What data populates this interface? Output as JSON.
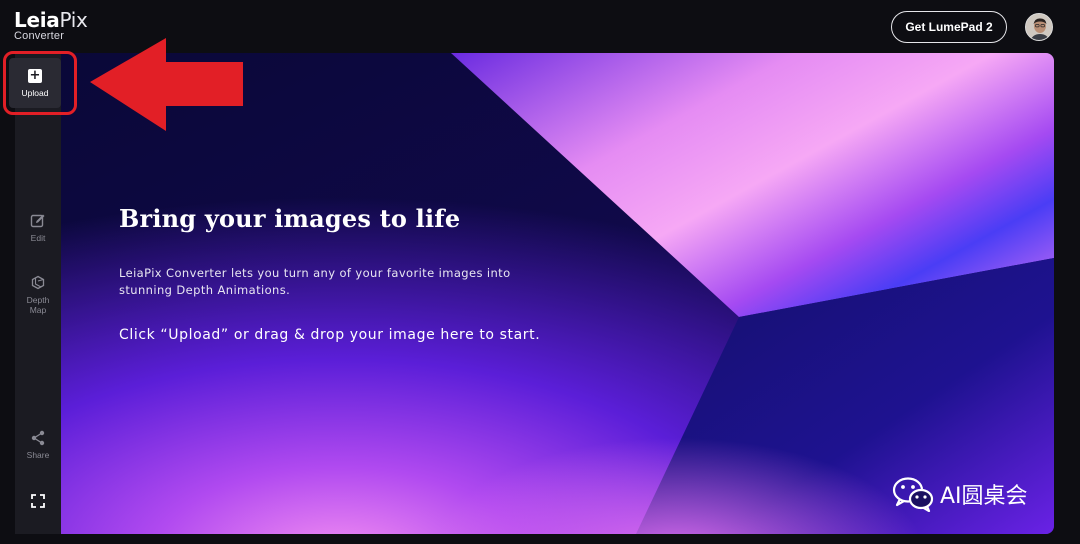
{
  "header": {
    "logo_bold": "Leia",
    "logo_thin": "Pix",
    "logo_sub": "Converter",
    "cta_label": "Get LumePad 2"
  },
  "sidebar": {
    "upload_label": "Upload",
    "items": [
      {
        "label": "Edit",
        "icon": "edit-icon"
      },
      {
        "label": "Depth Map",
        "icon": "depth-map-icon"
      },
      {
        "label": "Share",
        "icon": "share-icon"
      },
      {
        "label": "",
        "icon": "fullscreen-icon"
      }
    ]
  },
  "main": {
    "headline": "Bring your images to life",
    "description": "LeiaPix Converter lets you turn any of your favorite images into stunning Depth Animations.",
    "hint": "Click “Upload” or drag & drop your image here to start."
  },
  "annotation": {
    "highlight_color": "#e21f26"
  },
  "watermark": {
    "text": "AI圆桌会"
  },
  "colors": {
    "background": "#0d0d12",
    "sidebar": "#1b1b22",
    "canvas_deep": "#0e0a45",
    "canvas_violet": "#5a1fd6",
    "canvas_pink": "#f29cf0"
  }
}
